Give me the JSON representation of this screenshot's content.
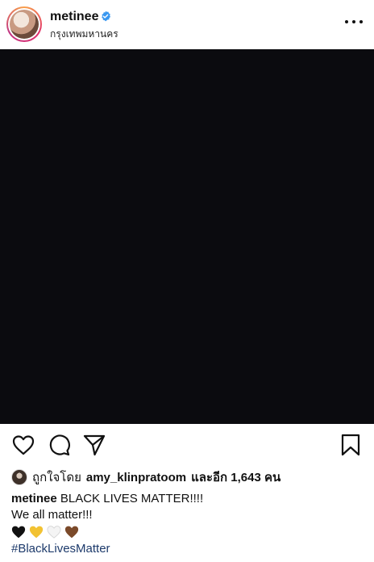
{
  "post": {
    "username": "metinee",
    "location": "กรุงเทพมหานคร",
    "liked_by_prefix": "ถูกใจโดย",
    "liked_by_user": "amy_klinpratoom",
    "liked_by_suffix": "และอีก 1,643 คน",
    "caption_username": "metinee",
    "caption_line1": "BLACK LIVES MATTER!!!!",
    "caption_line2": "We all matter!!!",
    "hashtag": "#BlackLivesMatter",
    "hearts": [
      {
        "name": "black-heart-icon",
        "color": "#111111"
      },
      {
        "name": "yellow-heart-icon",
        "color": "#f2c232"
      },
      {
        "name": "white-heart-icon",
        "color": "#f4f4f4"
      },
      {
        "name": "brown-heart-icon",
        "color": "#7b4a2a"
      }
    ]
  },
  "colors": {
    "photo_background": "#0b0b0f",
    "verified_badge": "#3897f0",
    "hashtag": "#1d3a6b"
  },
  "icons": {
    "like": "heart-outline-icon",
    "comment": "comment-bubble-icon",
    "share": "paper-plane-icon",
    "save": "bookmark-icon",
    "more": "more-options-icon",
    "verified": "verified-badge-icon"
  }
}
